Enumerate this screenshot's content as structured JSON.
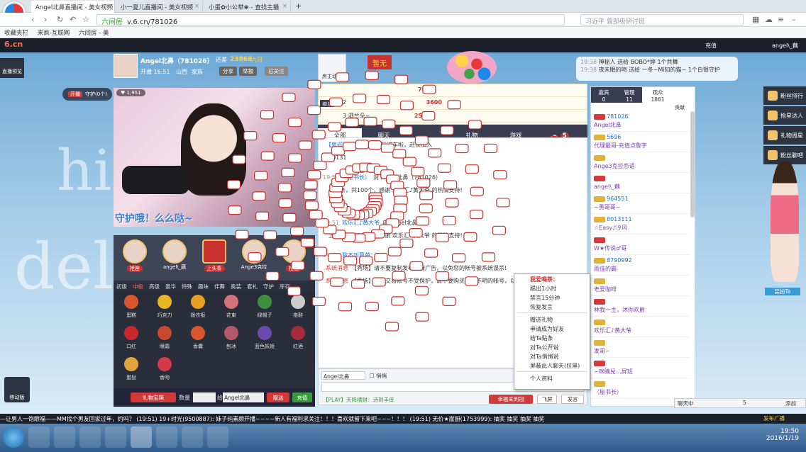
{
  "browser": {
    "tabs": [
      {
        "title": "Angel北鼻直播间 - 美女视频",
        "active": true
      },
      {
        "title": "小一夏儿直播间 - 美女视频",
        "active": false
      },
      {
        "title": "小蛋✿小公举❀ - 查找主播",
        "active": false
      }
    ],
    "url_prefix": "六间房",
    "url": "v.6.cn/781026",
    "search_placeholder": "习近平 曾部级研讨班",
    "bookmarks": [
      "收藏夹栏",
      "来疯-互联网",
      "六间房 - 美"
    ]
  },
  "site": {
    "logo": "6.cn",
    "header_right": [
      "充值",
      "angel\\_藕"
    ],
    "left_rail": "直播预览",
    "move_label": "移动版",
    "bg_words": [
      "hig",
      "del"
    ]
  },
  "host": {
    "name": "Angel北鼻（781026）",
    "level_label": "还差",
    "score": "23868",
    "level_tag": "六冠",
    "time": "开播 16:51",
    "location": "山西",
    "family_label": "家族",
    "share": "分享",
    "report": "举报",
    "followed": "已关注",
    "open_label": "开播",
    "guard_label": "守护(0个)",
    "fans": "1,951",
    "caption": "守护哦！么么哒~",
    "room_state": "房主动态",
    "badge": "暂无"
  },
  "seats": [
    {
      "name": "",
      "label": "抢座"
    },
    {
      "name": "angel\\_藕",
      "label": "抢座"
    },
    {
      "name": "上头条",
      "label": ""
    },
    {
      "name": "Ange3克拉",
      "label": ""
    },
    {
      "name": "",
      "label": "抢座"
    }
  ],
  "gift_tabs": [
    "初级",
    "中级",
    "高级",
    "豪华",
    "特殊",
    "趣味",
    "伴舞",
    "奥装",
    "套礼",
    "守护",
    "库存"
  ],
  "gift_tabs_active": 1,
  "gifts": [
    {
      "name": "蛋糕",
      "color": "#d9572c"
    },
    {
      "name": "巧克力",
      "color": "#e6b422"
    },
    {
      "name": "拨衣板",
      "color": "#e8a020"
    },
    {
      "name": "花束",
      "color": "#d4707a"
    },
    {
      "name": "绿帽子",
      "color": "#3d8f3d"
    },
    {
      "name": "拖鞋",
      "color": "#cccccc"
    },
    {
      "name": "口红",
      "color": "#c8282d"
    },
    {
      "name": "眼霜",
      "color": "#c84a2d"
    },
    {
      "name": "香囊",
      "color": "#d9572c"
    },
    {
      "name": "刨冰",
      "color": "#b35a6a"
    },
    {
      "name": "蓝色妖姬",
      "color": "#6a4ab0"
    },
    {
      "name": "红酒",
      "color": "#a52b3a"
    },
    {
      "name": "蛋挞",
      "color": "#e0a43a"
    },
    {
      "name": "香吻",
      "color": "#d63a4a"
    }
  ],
  "gift_bar": {
    "treasure": "礼物宝箱",
    "qty_label": "数量",
    "to_label": "给",
    "target": "Angel北鼻",
    "send": "赠送",
    "recharge": "充值"
  },
  "rank": [
    {
      "pos": "",
      "name": "",
      "score": "7600"
    },
    {
      "pos": "2",
      "name": "",
      "score": "3600"
    },
    {
      "pos": "3",
      "name": "泗兰朵~",
      "score": "2500"
    }
  ],
  "rank_tag": "榜单",
  "chat_tabs": [
    "全部",
    "聊天",
    "",
    "礼物",
    "游戏",
    ""
  ],
  "chat_badge": "5",
  "chat": [
    {
      "time": "",
      "user": "【房间公告】:",
      "text": "充100就送车啦，赶快加入",
      "sys": false
    },
    {
      "time": "",
      "user": "",
      "text": "80131",
      "sys": false
    },
    {
      "time": "19:51",
      "user": "（秘书长）",
      "text": "对 Angel北鼻（781026）",
      "sys": false
    },
    {
      "time": "",
      "user": "",
      "text": "上头条，共100个，感谢 欢乐汇♪黄大爷 的热情支持!",
      "sys": false
    },
    {
      "time": "",
      "user": "",
      "text": "一休哥",
      "sys": false
    },
    {
      "time": "19:51",
      "user": "欢乐汇♪黄大爷",
      "text": "向 Angel北鼻",
      "sys": false
    },
    {
      "time": "",
      "user": "",
      "text": "上头条，共100个，感谢 欢乐汇♪黄大爷 的热情支持!",
      "sys": false
    },
    {
      "time": "19:51",
      "user": "我不叫葛芭：",
      "text": "",
      "sys": false
    },
    {
      "time": "",
      "user": "系统消息",
      "text": "【秀场】请不要复制发布色情广告，以免您的帐号被系统误杀!",
      "sys": true
    },
    {
      "time": "",
      "user": "系统消息",
      "text": "【秀场】私下交易帐号不受保护，请不要购买来路不明的帐号，以免您的利益受到损失",
      "sys": true
    }
  ],
  "input": {
    "target": "Angel北鼻",
    "private_label": "悄悄",
    "hint": "【PLAY】天降横财：诗到手痒",
    "luck": "幸福来到冠",
    "fly": "飞屏",
    "send": "发言"
  },
  "context_menu": {
    "header": "我爱喝茶：",
    "items": [
      "踢出1小时",
      "禁言15分钟",
      "恢复发言",
      "赠送礼物",
      "申请成为好友",
      "给Ta贴条",
      "对Ta公开说",
      "对Ta悄悄说",
      "屏蔽此人聊天(拉黑)",
      "个人资料"
    ]
  },
  "users_tabs": [
    {
      "label": "嘉宾",
      "count": "0"
    },
    {
      "label": "管理",
      "count": "11"
    },
    {
      "label": "观众",
      "count": "1861"
    }
  ],
  "users_contribution": "贡献",
  "users": [
    {
      "name": "781026",
      "sub": "Angel北鼻"
    },
    {
      "name": "5696",
      "sub": "代理最哥-充值点鲁字"
    },
    {
      "name": "",
      "sub": "Ange3克拉恋语"
    },
    {
      "name": "",
      "sub": "angel\\_藕"
    },
    {
      "name": "964551",
      "sub": "~勇哥哥~"
    },
    {
      "name": "8013111",
      "sub": "☆Easy♪冷风"
    },
    {
      "name": "",
      "sub": "W★传说♂哥"
    },
    {
      "name": "8790992",
      "sub": "雨佳的霸"
    },
    {
      "name": "",
      "sub": "老爱咖啡"
    },
    {
      "name": "",
      "sub": "林我一主，沐你欢爵"
    },
    {
      "name": "",
      "sub": "欢乐汇♪黄大爷"
    },
    {
      "name": "",
      "sub": "发哥~"
    },
    {
      "name": "",
      "sub": "~咪睛兒…屏班"
    },
    {
      "name": "",
      "sub": "（秘书长）"
    }
  ],
  "right_rail": [
    "粉丝排行",
    "抢星达人",
    "礼物周星",
    "粉丝聊吧"
  ],
  "anchor_figure": "装扮Ta",
  "banner": [
    {
      "time": "19:38",
      "text": "神秘人 送给 BOBO*婷 1个共舞"
    },
    {
      "time": "19:38",
      "text": "夜未眠的吻 送给 一冬~Mi知的猫~ 1个白银守护"
    }
  ],
  "ticker": "—让男人一饱眼福——MM找个男友回家过年，约吗？   (19:51)   19+时光(9500887): 妹子纯素颜开播~~~~新人有福利求关注！！！喜欢就留下来吧~~~！！！  (19:51)  无价★崖厨(1753999): 抽奖   抽奖   抽奖   抽奖",
  "bottom_right": [
    "聊天中",
    "5",
    "添加"
  ],
  "post_label": "发布广播",
  "taskbar": {
    "time": "19:50",
    "date": "2016/1/19"
  }
}
